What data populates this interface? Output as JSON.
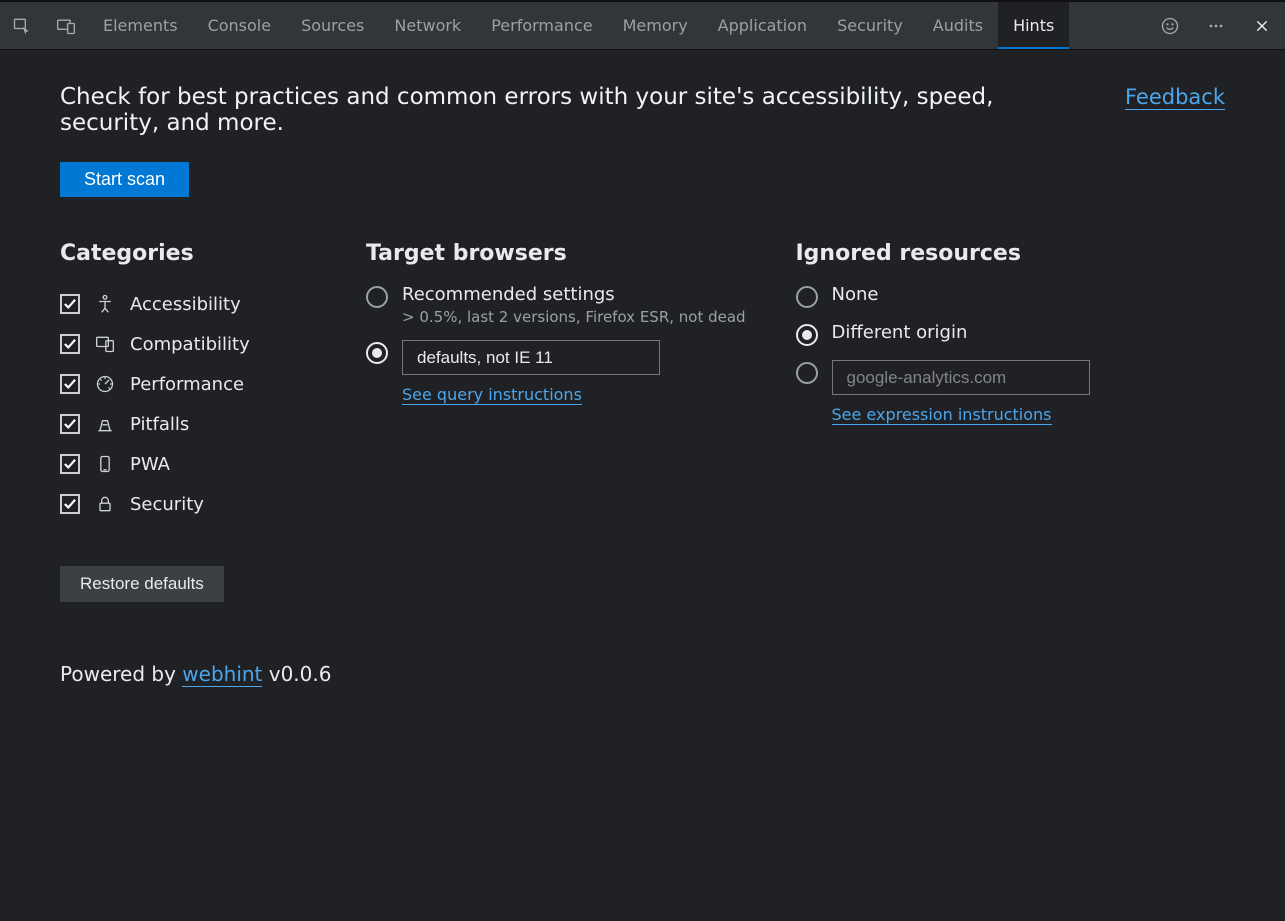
{
  "toolbar": {
    "tabs": [
      "Elements",
      "Console",
      "Sources",
      "Network",
      "Performance",
      "Memory",
      "Application",
      "Security",
      "Audits",
      "Hints"
    ],
    "active_tab": "Hints"
  },
  "intro": "Check for best practices and common errors with your site's accessibility, speed, security, and more.",
  "feedback_label": "Feedback",
  "start_scan_label": "Start scan",
  "categories": {
    "title": "Categories",
    "items": [
      {
        "label": "Accessibility",
        "checked": true,
        "icon": "accessibility"
      },
      {
        "label": "Compatibility",
        "checked": true,
        "icon": "compatibility"
      },
      {
        "label": "Performance",
        "checked": true,
        "icon": "performance"
      },
      {
        "label": "Pitfalls",
        "checked": true,
        "icon": "pitfalls"
      },
      {
        "label": "PWA",
        "checked": true,
        "icon": "pwa"
      },
      {
        "label": "Security",
        "checked": true,
        "icon": "security"
      }
    ],
    "restore_label": "Restore defaults"
  },
  "target_browsers": {
    "title": "Target browsers",
    "recommended": {
      "label": "Recommended settings",
      "detail": "> 0.5%, last 2 versions, Firefox ESR, not dead",
      "selected": false
    },
    "custom": {
      "value": "defaults, not IE 11",
      "selected": true,
      "link": "See query instructions"
    }
  },
  "ignored_resources": {
    "title": "Ignored resources",
    "none_label": "None",
    "none_selected": false,
    "different_origin_label": "Different origin",
    "different_origin_selected": true,
    "custom_placeholder": "google-analytics.com",
    "custom_selected": false,
    "link": "See expression instructions"
  },
  "powered": {
    "prefix": "Powered by ",
    "link": "webhint",
    "suffix": " v0.0.6"
  }
}
